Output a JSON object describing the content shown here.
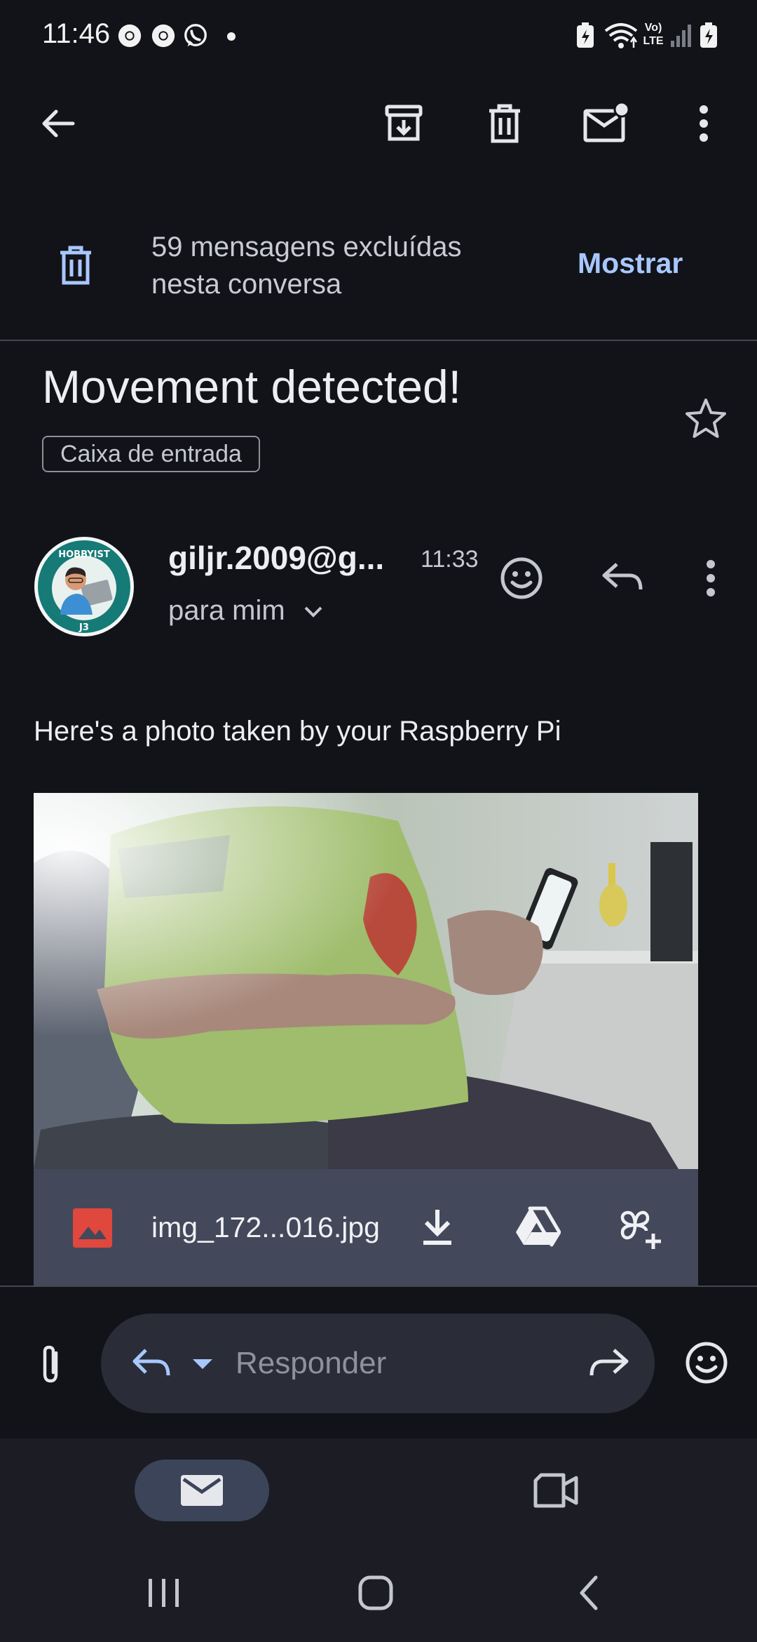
{
  "status_bar": {
    "time": "11:46",
    "left_icons": [
      "chrome-icon",
      "chrome-icon",
      "whatsapp-icon",
      "dot-icon"
    ],
    "right_icons": [
      "battery-saver-icon",
      "wifi-icon",
      "volte-icon",
      "signal-icon",
      "battery-icon"
    ],
    "volte_text": "Vo) LTE"
  },
  "toolbar": {
    "back": "back-arrow-icon",
    "archive": "archive-icon",
    "delete": "trash-icon",
    "mark_unread": "mail-unread-icon",
    "more": "more-vert-icon"
  },
  "deleted_banner": {
    "line1": "59 mensagens excluídas",
    "line2": "nesta conversa",
    "action": "Mostrar"
  },
  "message": {
    "subject": "Movement detected!",
    "label": "Caixa de entrada",
    "sender": "giljr.2009@g...",
    "time": "11:33",
    "recipient": "para mim",
    "body": "Here's a photo taken by your Raspberry Pi",
    "avatar_text_top": "HOBBYIST",
    "avatar_text_bottom": "J3"
  },
  "attachment": {
    "filename": "img_172...016.jpg",
    "icons": [
      "image-file-icon",
      "download-icon",
      "google-drive-icon",
      "add-to-photos-icon"
    ]
  },
  "reply_bar": {
    "placeholder": "Responder"
  },
  "bottom_nav": {
    "items": [
      "mail-icon",
      "video-icon"
    ],
    "selected": "mail-icon"
  },
  "colors": {
    "background": "#121318",
    "accent": "#a9c7ff",
    "attachment_bar": "#43495a",
    "nav_pill": "#3b4458",
    "reply_pill": "#2a2d37"
  }
}
